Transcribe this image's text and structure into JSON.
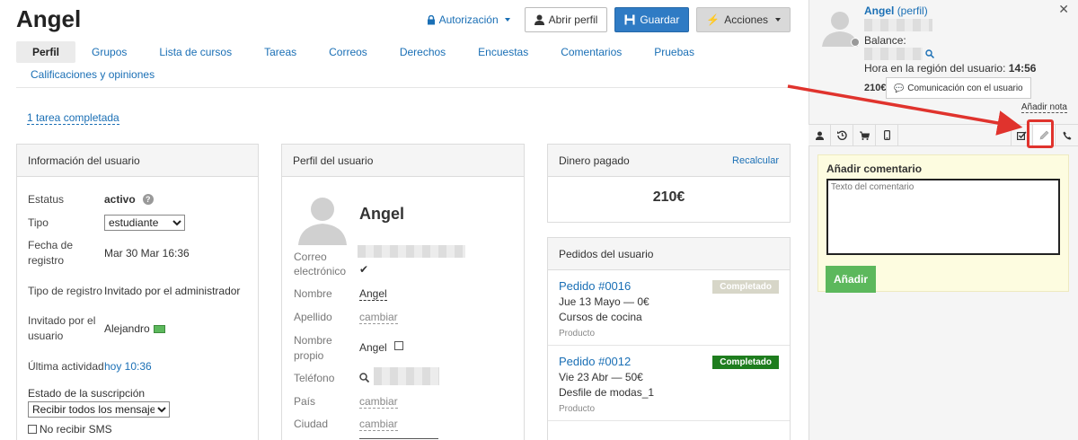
{
  "header": {
    "title": "Angel",
    "auth_label": "Autorización",
    "open_profile_label": "Abrir perfil",
    "save_label": "Guardar",
    "actions_label": "Acciones"
  },
  "tabs": [
    "Perfil",
    "Grupos",
    "Lista de cursos",
    "Tareas",
    "Correos",
    "Derechos",
    "Encuestas",
    "Comentarios",
    "Pruebas"
  ],
  "tab_row2": [
    "Calificaciones y opiniones"
  ],
  "task_link": "1 tarea completada",
  "user_info": {
    "title": "Información del usuario",
    "status_label": "Estatus",
    "status_value": "activo",
    "type_label": "Tipo",
    "type_value": "estudiante",
    "reg_date_label": "Fecha de registro",
    "reg_date_value": "Mar 30 Mar 16:36",
    "reg_type_label": "Tipo de registro",
    "reg_type_value": "Invitado por el administrador",
    "invited_label": "Invitado por el usuario",
    "invited_value": "Alejandro",
    "last_activity_label": "Última actividad",
    "last_activity_value": "hoy 10:36",
    "subscription_label": "Estado de la suscripción",
    "subscription_value": "Recibir todos los mensajes",
    "no_sms_label": "No recibir SMS"
  },
  "profile": {
    "title": "Perfil del usuario",
    "name": "Angel",
    "email_label": "Correo electrónico",
    "first_name_label": "Nombre",
    "first_name_value": "Angel",
    "last_name_label": "Apellido",
    "change_label": "cambiar",
    "own_name_label": "Nombre propio",
    "own_name_value": "Angel",
    "phone_label": "Teléfono",
    "country_label": "País",
    "city_label": "Ciudad"
  },
  "money": {
    "title": "Dinero pagado",
    "recalc_label": "Recalcular",
    "amount": "210€"
  },
  "orders": {
    "title": "Pedidos del usuario",
    "items": [
      {
        "title": "Pedido #0016",
        "date": "Jue 13 Mayo — 0€",
        "course": "Cursos de cocina",
        "type": "Producto",
        "status": "Completado",
        "status_color": "#d7d6c8"
      },
      {
        "title": "Pedido #0012",
        "date": "Vie 23 Abr — 50€",
        "course": "Desfile de modas_1",
        "type": "Producto",
        "status": "Completado",
        "status_color": "#1e7d1e"
      }
    ]
  },
  "sidebar": {
    "name": "Angel",
    "profile_link": "(perfil)",
    "balance_label": "Balance:",
    "time_label": "Hora en la región del usuario:",
    "time_value": "14:56",
    "balance_amount": "210€",
    "comm_label": "Comunicación con el usuario",
    "add_note_label": "Añadir nota",
    "comment_title": "Añadir comentario",
    "comment_placeholder": "Texto del comentario",
    "add_button": "Añadir",
    "tab_icons": [
      "user-icon",
      "history-icon",
      "cart-icon",
      "mobile-icon",
      "check-icon",
      "pencil-icon",
      "phone-icon"
    ]
  },
  "colors": {
    "primary": "#2f7bc4",
    "link": "#1a6fb5",
    "success": "#5cb85c",
    "highlight": "#e0332d"
  }
}
